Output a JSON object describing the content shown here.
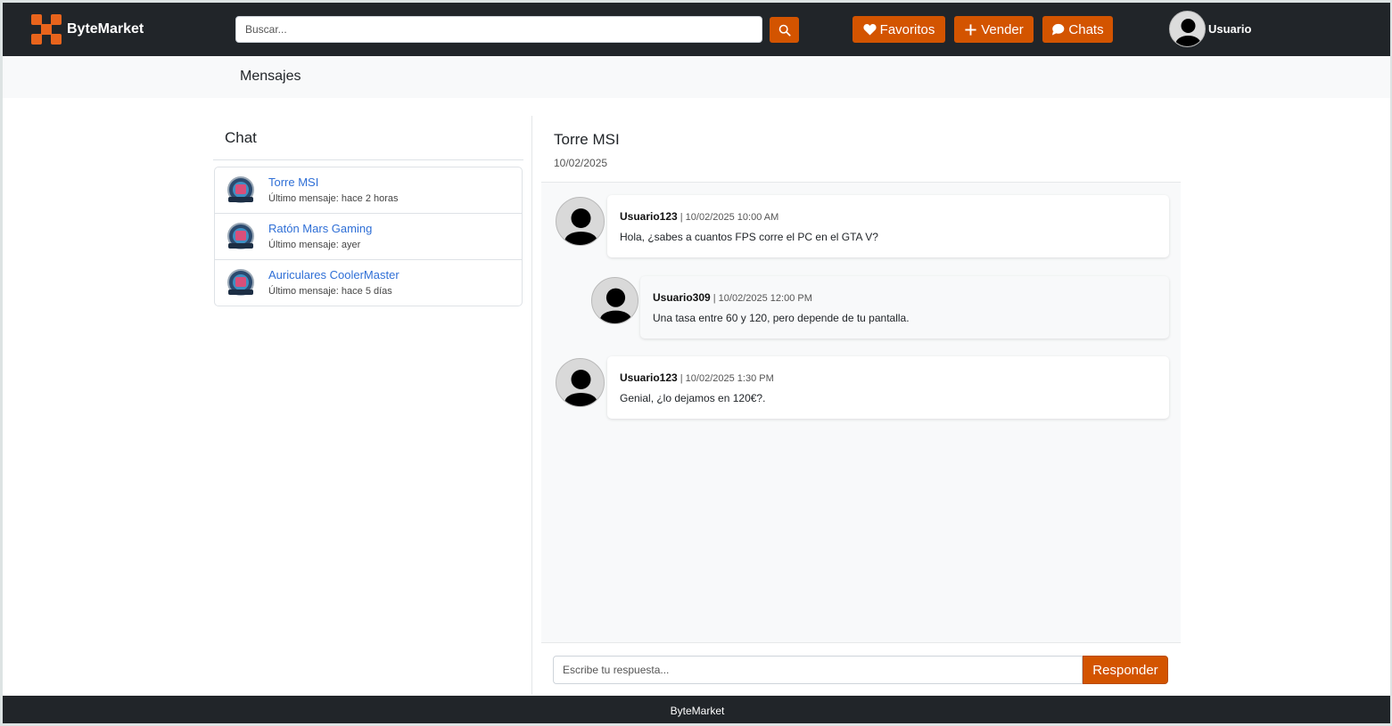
{
  "navbar": {
    "brand_name": "ByteMarket",
    "search_placeholder": "Buscar...",
    "favorites_label": "Favoritos",
    "sell_label": "Vender",
    "chats_label": "Chats",
    "user_label": "Usuario",
    "accent_color": "#d35400"
  },
  "subheader": {
    "title": "Mensajes"
  },
  "chat_panel": {
    "heading": "Chat",
    "items": [
      {
        "title": "Torre MSI",
        "subtitle": "Último mensaje: hace 2 horas"
      },
      {
        "title": "Ratón Mars Gaming",
        "subtitle": "Último mensaje: ayer"
      },
      {
        "title": "Auriculares CoolerMaster",
        "subtitle": "Último mensaje: hace 5 días"
      }
    ]
  },
  "conversation": {
    "title": "Torre MSI",
    "date": "10/02/2025",
    "messages": [
      {
        "author": "Usuario123",
        "timestamp": "| 10/02/2025 10:00 AM",
        "text": "Hola, ¿sabes a cuantos FPS corre el PC en el GTA V?"
      },
      {
        "author": "Usuario309",
        "timestamp": "| 10/02/2025 12:00 PM",
        "text": "Una tasa entre 60 y 120, pero depende de tu pantalla."
      },
      {
        "author": "Usuario123",
        "timestamp": "| 10/02/2025 1:30 PM",
        "text": "Genial, ¿lo dejamos en 120€?."
      }
    ],
    "reply_placeholder": "Escribe tu respuesta...",
    "reply_button": "Responder"
  },
  "footer": {
    "text": "ByteMarket"
  }
}
